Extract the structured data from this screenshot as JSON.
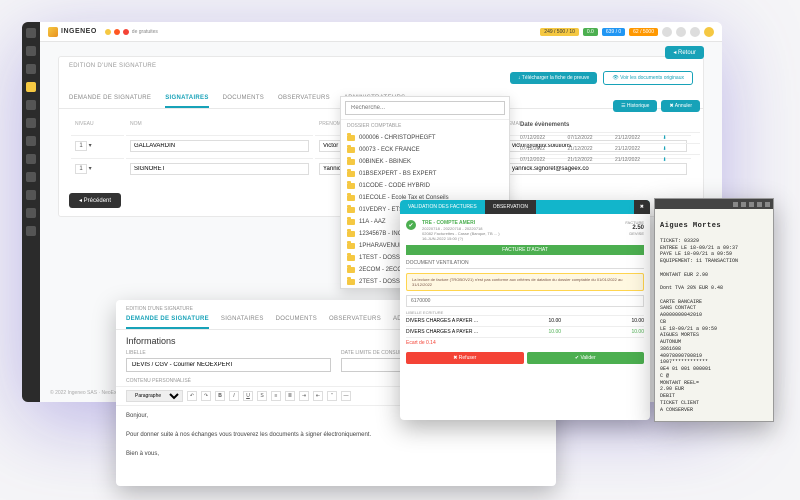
{
  "app": {
    "name": "INGENEO"
  },
  "topbar": {
    "alert_count": "de gratuites",
    "badges": {
      "b1": "249 / 500 / 10",
      "b2": "0.0",
      "b3": "639 / 0",
      "b4": "62 / 5000"
    },
    "return_label": "◂ Retour",
    "download_fiche": "↓ Télécharger la fiche de preuve",
    "voir_docs": "👁 Voir les documents originaux"
  },
  "panel1": {
    "title": "EDITION D'UNE SIGNATURE",
    "tabs": [
      "DEMANDE DE SIGNATURE",
      "SIGNATAIRES",
      "DOCUMENTS",
      "OBSERVATEURS",
      "ADMINISTRATEURS"
    ],
    "active_tab": 1,
    "cols": [
      "NIVEAU",
      "NOM",
      "PRENOM",
      "EMAIL"
    ],
    "rows": [
      {
        "n": "1",
        "nom": "GALLAVARDIN",
        "prenom": "Victor",
        "email": "victor@digitv.solutions"
      },
      {
        "n": "1",
        "nom": "SIGNORET",
        "prenom": "Yannick",
        "email": "yannick.signoret@sageex.co"
      }
    ],
    "prev_btn": "◂ Précédent"
  },
  "dropdown": {
    "placeholder": "Recherche...",
    "section_label": "DOSSIER COMPTABLE",
    "items": [
      "000006 - CHRISTOPHEGFT",
      "00073 - ECK FRANCE",
      "00BINEK - BBINEK",
      "01BSEXPERT - BS EXPERT",
      "01CODE - CODE HYBRID",
      "01ECOLE - Ecole Tax et Conseils",
      "01VEDRY - ETS VEDRY",
      "11A - AAZ",
      "1234567B - INGENEO - MAE EXPERTISE",
      "1PHARAVENUE - PHARMACIE DE L'AVENUE",
      "1TEST - DOSSIER TSAGE",
      "2ECOM - 2ECOM",
      "2TEST - DOSSIER 2SAGE"
    ]
  },
  "right_panel": {
    "btn1": "☰ Historique",
    "btn2": "✖ Annuler",
    "header": "Date évènements",
    "rows": [
      {
        "d1": "07/12/2022",
        "d2": "07/12/2022",
        "d3": "21/12/2022"
      },
      {
        "d1": "07/12/2022",
        "d2": "21/12/2022",
        "d3": "21/12/2022"
      },
      {
        "d1": "07/12/2022",
        "d2": "21/12/2022",
        "d3": "21/12/2022"
      }
    ]
  },
  "invoice": {
    "tab1": "VALIDATION DES FACTURES",
    "tab2": "OBSERVATION",
    "account_label": "TRE - COMPTE AMERI",
    "doc_meta": "20220718 - 20220718 - 20220718\n02082 Facturettes - Casse (Banque, TB ... )\n16-JUN-2022 15:00 (?)",
    "amount_label": "FACTURE",
    "amount": "2.50",
    "devise": "DEVISE",
    "bar_text": "FACTURE D'ACHAT",
    "sub_tabs": "DOCUMENT          VENTILATION",
    "warn": "La lecture de facture (TROBOV21) n'est pas conforme aux critères de datation du dossier comptable du 01/01/2022 au 31/12/2022",
    "field1": "6170000",
    "line_label": "LIBELLE ECRITURE",
    "charges": "DIVERS CHARGES A PAYER ...",
    "ecart": "Ecart de 0.14",
    "v1": "10.00",
    "v2": "10.00",
    "v3": "10.00",
    "v4": "10.00",
    "btn_refuse": "✖ Refuser",
    "btn_validate": "✔ Valider"
  },
  "receipt": {
    "title": "Aigues Mortes",
    "body": "TICKET: 03329\nENTREE LE 18-09/21 a 09:37\nPAYE LE  18-09/21 a 09:59\nEQUIPEMENT: 11  TRANSACTION\n\nMONTANT  EUR 2.90\n\nDont TVA  20% EUR  0.48\n\nCARTE BANCAIRE\nSANS CONTACT\nA0000000042010\nCB\nLE 18-09/21 a 09:59\nAIGUES MORTES\nAUTONUM\n3861608\n40978090700819\n1007************\n0E4  01 001 000001\nC  @\nMONTANT REEL=\n       2.90 EUR\nDEBIT\nTICKET CLIENT\nA CONSERVER"
  },
  "form": {
    "title": "EDITION D'UNE SIGNATURE",
    "tabs": [
      "DEMANDE DE SIGNATURE",
      "SIGNATAIRES",
      "DOCUMENTS",
      "OBSERVATEURS",
      "ADMINISTRATEURS"
    ],
    "section": "Informations",
    "libelle_label": "LIBELLE",
    "libelle_value": "DEVIS / CGV - Courrier NEOEXPERT",
    "date_label": "DATE LIMITE DE CONSULTATION",
    "content_label": "CONTENU PERSONNALISÉ",
    "para_select": "Paragraphe",
    "body": "Bonjour,\n\nPour donner suite à nos échanges vous trouverez les documents à signer électroniquement.\n\nBien à vous,"
  },
  "footer": "© 2022 Ingeneo SAS · NeoExpert"
}
